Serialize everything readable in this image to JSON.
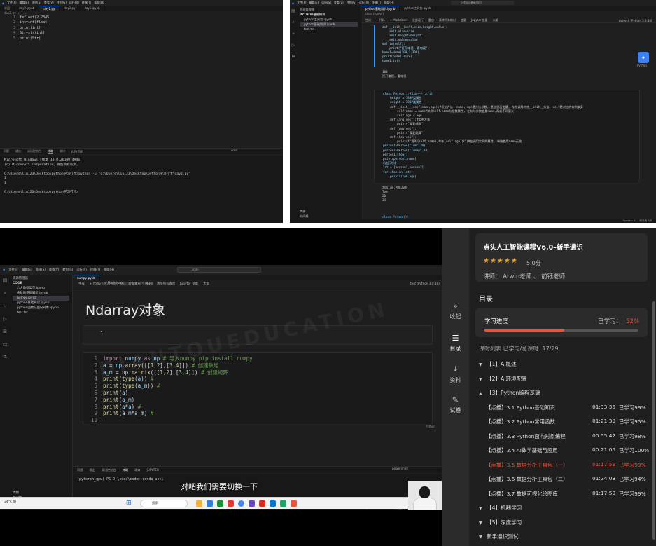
{
  "top_left": {
    "menus": [
      "文件(F)",
      "编辑(E)",
      "选择(S)",
      "查看(V)",
      "转到(G)",
      "运行(R)",
      "终端(T)",
      "帮助(H)"
    ],
    "tabs": [
      "欢迎",
      "day2.ipynb",
      "day2.py",
      "day1.py",
      "day1.ipynb"
    ],
    "breadcrumb": "day2.py > ...",
    "code": [
      "f=float(2.2345",
      "int=int(float)",
      "print(int)",
      "Str=str(int)",
      "print(Str)"
    ],
    "panel_tabs": [
      "问题",
      "输出",
      "调试控制台",
      "终端",
      "端口",
      "JUPYTER"
    ],
    "terminal": [
      "Microsoft Windows [版本 10.0.26100.4946]",
      "(c) Microsoft Corporation。保留所有权利。",
      "",
      "C:\\Users\\liu123\\Desktop\\python学习打卡>python -u \"c:\\Users\\liu123\\Desktop\\python学习打卡\\day2.py\"",
      "1",
      "1",
      "",
      "C:\\Users\\liu123\\Desktop\\python学习打卡>"
    ],
    "terminal_kind": "cmd"
  },
  "top_right": {
    "menus": [
      "文件(F)",
      "编辑(E)",
      "选择(S)",
      "查看(V)",
      "转到(G)",
      "运行(R)",
      "终端(T)",
      "帮助(H)"
    ],
    "search": "python基础知识",
    "sidebar_title": "资源管理器",
    "sidebar_items": [
      "PYTHON基础知识",
      "python工具包.ipynb",
      "python基础知识.ipynb",
      "test.txt"
    ],
    "tabs": [
      "python基础知识.ipynb",
      "python工具包.ipynb"
    ],
    "breadcrumb": "class Home():",
    "toolbar": [
      "生成",
      "+ 代码",
      "+ Markdown",
      "全部运行",
      "重启",
      "清除所有输出",
      "变量",
      "Jupyter 变量",
      "大纲"
    ],
    "kernel": "pytorch (Python 3.9.18)",
    "cell1": [
      "def __init__(self,size,height,value):",
      "    self.size=size",
      "    self.height=height",
      "    self.value=value",
      "def tv(self):",
      "    print(\"打开电视, 看电视\")",
      "home1=Home(100,3,300)",
      "print(home1.size)",
      "home1.tv()"
    ],
    "out1": [
      "100",
      "打开电视, 看电视"
    ],
    "cell2": [
      "class Person():#定义一个\"人\"类",
      "    height = 180#类属性",
      "    weight = 180#类属性",
      "    def __init__(self,name,age):#初始方法: name, age是方法参数, 是这里面变量, 存在调用的才__init__方法, self是对应的实例本身",
      "        self.name = name#实例self.name与参数属性, 在有与参数变量name,两者不同意义",
      "        self.age = age",
      "    def sing(self):#实例方法",
      "        print(\"我爱唱歌\")",
      "    def jump(self):",
      "        print(\"我爱跳舞\")",
      "    def show(self):",
      "        print(f\"我叫{self.name},今年{self.age}岁\")#在调用实例的属性, 单独使用name无效",
      "person1=Person(\"Tom\",20)",
      "person2=Person(\"Tommy\",34)",
      "person1.show()",
      "print(person1.name)",
      "#遍历方法",
      "lst = [person1,person2]",
      "for item in lst:",
      "    print(item.age)"
    ],
    "out2": [
      "我叫Tom,今年20岁",
      "Tom",
      "20",
      "34"
    ],
    "cell3": "class Person():",
    "status": [
      "Spaces: 4",
      "单元格 8/8"
    ],
    "logo_label": "Python",
    "sidebar_footer": [
      "大纲",
      "时间线"
    ]
  },
  "video": {
    "menus": [
      "文件(F)",
      "编辑(E)",
      "选择(S)",
      "查看(V)",
      "转到(G)",
      "运行(R)",
      "终端(T)",
      "帮助(H)"
    ],
    "search": "code",
    "sidebar_title": "资源管理器",
    "sidebar_items": [
      "CODE",
      "八大数据类型.ipynb",
      "函数的参数解析.ipynb",
      "numpy.ipynb",
      "python基础知识.ipynb",
      "python函数与面向对象.ipynb",
      "test.txt"
    ],
    "selected_item": "numpy.ipynb",
    "tab": "numpy.ipynb",
    "breadcrumb": "numpy.ipynb > Ndarray对象 > 空单元格",
    "toolbar": [
      "生成",
      "+ 代码",
      "+ Markdown",
      "全部运行",
      "重启",
      "清除所有输出",
      "Jupyter 变量",
      "大纲"
    ],
    "kernel": "test (Python 3.9.18)",
    "heading": "Ndarray对象",
    "raw_cell": "1",
    "code_lines": [
      {
        "n": "1",
        "html": "<span class='kw'>import</span> <span class='vr'>numpy</span> <span class='kw'>as</span> <span class='vr'>np</span> <span class='cm'># 导入numpy pip install numpy</span>"
      },
      {
        "n": "2",
        "html": "<span class='vr'>a</span> = <span class='vr'>np</span>.<span class='fn'>array</span>([[<span class='nm'>1</span>,<span class='nm'>2</span>],[<span class='nm'>3</span>,<span class='nm'>4</span>]]) <span class='cm'># 创建数组</span>"
      },
      {
        "n": "3",
        "html": "<span class='vr'>a_m</span> = <span class='vr'>np</span>.<span class='fn'>matrix</span>([[<span class='nm'>1</span>,<span class='nm'>2</span>],[<span class='nm'>3</span>,<span class='nm'>4</span>]]) <span class='cm'># 创建矩阵</span>"
      },
      {
        "n": "4",
        "html": "<span class='fn'>print</span>(<span class='fn'>type</span>(<span class='vr'>a</span>)) <span class='cm'>#</span>"
      },
      {
        "n": "5",
        "html": "<span class='fn'>print</span>(<span class='fn'>type</span>(<span class='vr'>a_m</span>)) <span class='cm'>#</span>"
      },
      {
        "n": "6",
        "html": "<span class='fn'>print</span>(<span class='vr'>a</span>)"
      },
      {
        "n": "7",
        "html": "<span class='fn'>print</span>(<span class='vr'>a_m</span>)"
      },
      {
        "n": "8",
        "html": "<span class='fn'>print</span>(<span class='vr'>a</span>*<span class='vr'>a</span>) <span class='cm'>#</span>"
      },
      {
        "n": "9",
        "html": "<span class='fn'>print</span>(<span class='vr'>a_m</span>*<span class='vr'>a_m</span>) <span class='cm'>#</span>"
      },
      {
        "n": "10",
        "html": ""
      }
    ],
    "cell_lang": "Python",
    "panel_tabs": [
      "问题",
      "输出",
      "调试控制台",
      "终端",
      "端口",
      "JUPYTER"
    ],
    "terminal_kind": "powershell",
    "terminal": "(pytorch_gpu) PS D:\\code\\code> conda acti",
    "status": [
      "Spaces: 4",
      "CRLF",
      "单元格 2/2"
    ],
    "sidebar_footer": [
      "大纲",
      "时间线"
    ],
    "subtitle": "对吧我们需要切换一下",
    "taskbar_search": "搜索",
    "weather": "24°C 阴",
    "watermark": "DIANTOUEDUCATION"
  },
  "rail": [
    {
      "icon": "»",
      "label": "收起"
    },
    {
      "icon": "☰",
      "label": "目录"
    },
    {
      "icon": "⤓",
      "label": "资料"
    },
    {
      "icon": "✎",
      "label": "试卷"
    }
  ],
  "course": {
    "title": "点头人工智能课程V6.0–新手通识",
    "rating": "5.0分",
    "stars": "★★★★★",
    "teacher": "讲师： Arwin老师 、 前钰老师",
    "toc_label": "目录",
    "progress_label": "学习进度",
    "progress_prefix": "已学习：",
    "progress_pct": "52%",
    "progress_value": 52,
    "list_header": "课时列表   已学习/总课时:   17/29",
    "sections_before": [
      {
        "arrow": "▼",
        "label": "【1】AI概述"
      },
      {
        "arrow": "▼",
        "label": "【2】AI环境配置"
      },
      {
        "arrow": "▲",
        "label": "【3】Python编程基础"
      }
    ],
    "lessons": [
      {
        "title": "【点播】3.1 Python基础知识",
        "dur": "01:33:35",
        "done": "已学习99%"
      },
      {
        "title": "【点播】3.2 Python常用函数",
        "dur": "01:21:39",
        "done": "已学习95%"
      },
      {
        "title": "【点播】3.3 Python面向对象编程",
        "dur": "00:55:42",
        "done": "已学习98%"
      },
      {
        "title": "【点播】3.4 AI数学基础与应用",
        "dur": "00:21:05",
        "done": "已学习100%"
      },
      {
        "title": "【点播】3.5 数据分析工具包（一）",
        "dur": "01:17:53",
        "done": "已学习99%"
      },
      {
        "title": "【点播】3.6 数据分析工具包（二）",
        "dur": "01:24:03",
        "done": "已学习94%"
      },
      {
        "title": "【点播】3.7 数据可视化绘图库",
        "dur": "01:17:59",
        "done": "已学习99%"
      }
    ],
    "current_lesson_index": 4,
    "sections_after": [
      {
        "arrow": "▼",
        "label": "【4】机器学习"
      },
      {
        "arrow": "▼",
        "label": "【5】深度学习"
      },
      {
        "arrow": "▼",
        "label": "新手通识测试"
      },
      {
        "arrow": "▼",
        "label": "开班–框架介绍"
      }
    ],
    "accent": "#e8533c"
  }
}
